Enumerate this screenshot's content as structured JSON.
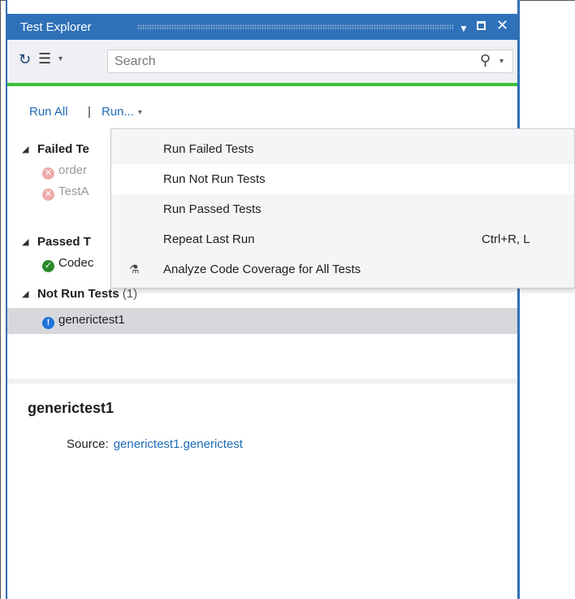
{
  "window": {
    "title": "Test Explorer",
    "buttons": {
      "dropdown": "▼",
      "maximize": "",
      "close": "✕"
    }
  },
  "toolbar": {
    "refresh_icon": "↻",
    "group_icon": "☰",
    "caret": "▾",
    "search": {
      "placeholder": "Search",
      "value": ""
    },
    "search_icon": "⚲"
  },
  "run_bar": {
    "run_all": "Run All",
    "separator": "|",
    "run_menu": "Run...",
    "caret": "▾"
  },
  "tree": {
    "groups": [
      {
        "label": "Failed Te",
        "count": ""
      },
      {
        "label": "Passed T",
        "count": ""
      },
      {
        "label": "Not Run Tests",
        "count": "(1)"
      }
    ],
    "failed_items": [
      {
        "label": "order"
      },
      {
        "label": "TestA"
      }
    ],
    "passed_items": [
      {
        "label": "Codec"
      }
    ],
    "not_run_items": [
      {
        "label": "generictest1"
      }
    ]
  },
  "detail": {
    "name": "generictest1",
    "source_label": "Source:",
    "source_value": "generictest1.generictest"
  },
  "menu": {
    "items": [
      {
        "label": "Run Failed Tests",
        "shortcut": ""
      },
      {
        "label": "Run Not Run Tests",
        "shortcut": ""
      },
      {
        "label": "Run Passed Tests",
        "shortcut": ""
      },
      {
        "label": "Repeat Last Run",
        "shortcut": "Ctrl+R, L"
      },
      {
        "label": "Analyze Code Coverage for All Tests",
        "shortcut": "",
        "icon": "⚗"
      }
    ]
  },
  "colors": {
    "title_bar": "#2f71b8",
    "progress_bar": "#39c13a",
    "link": "#1e6bb8",
    "selected_row": "#d7d8dc"
  }
}
